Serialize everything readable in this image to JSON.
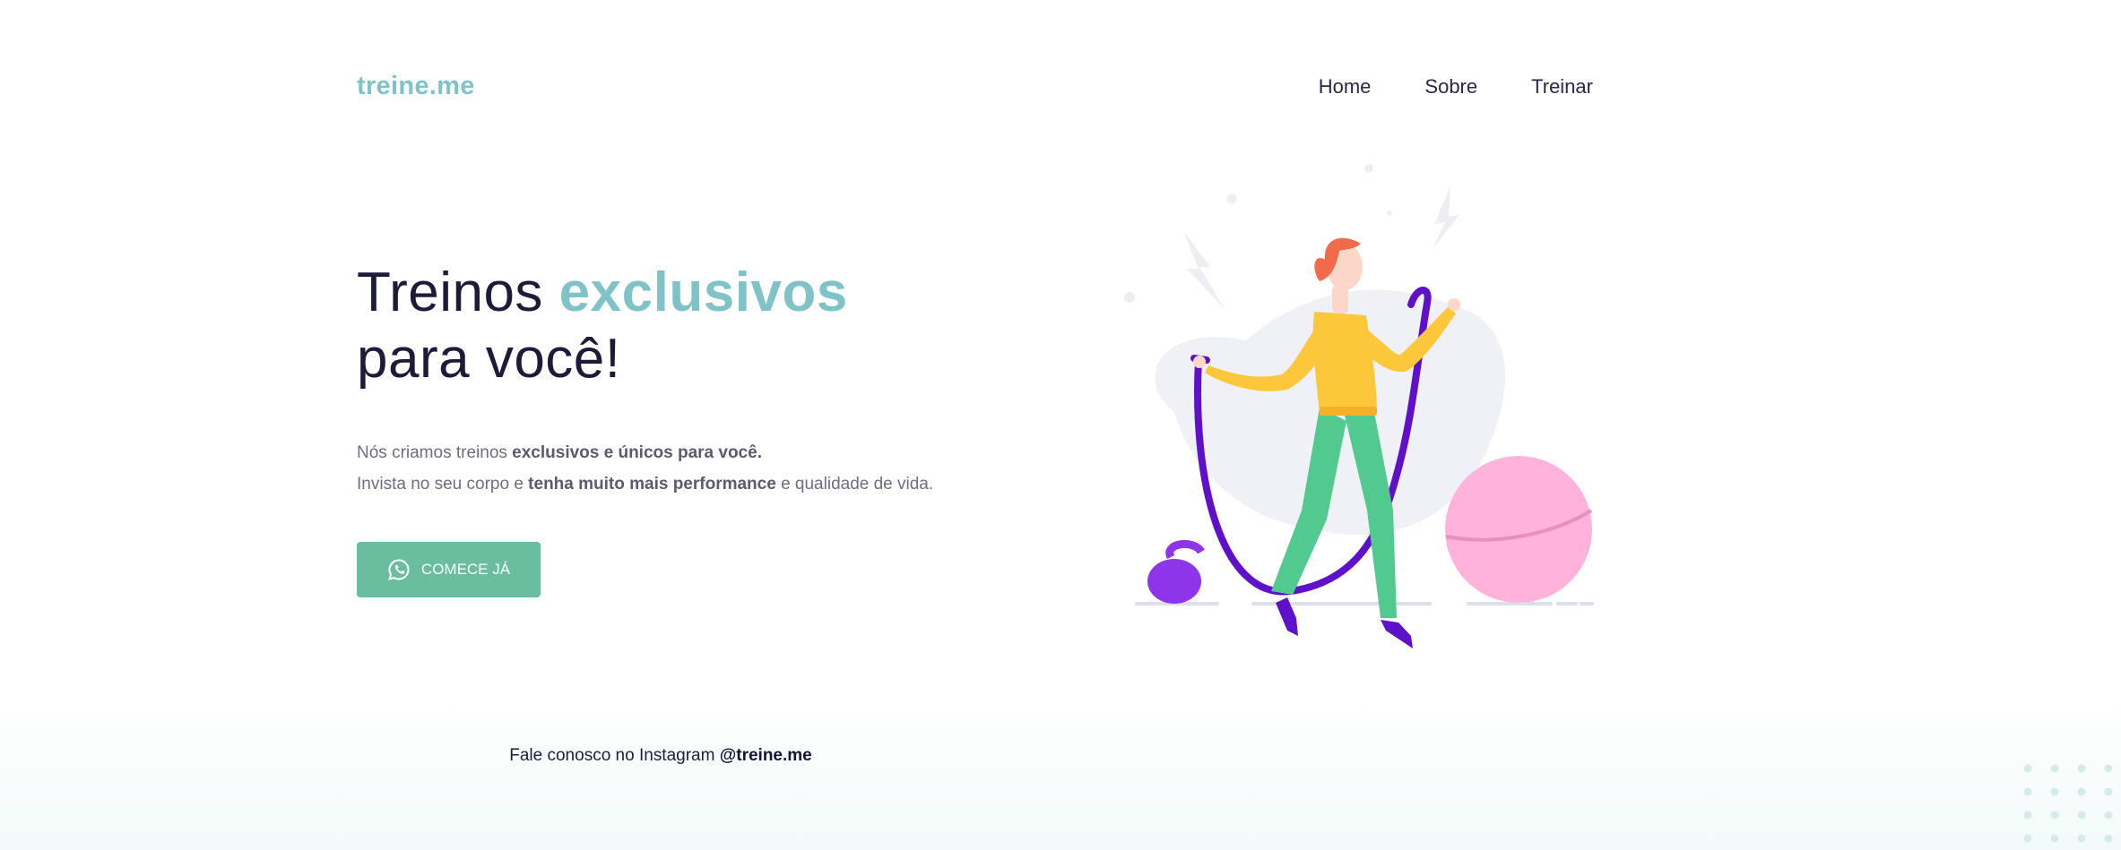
{
  "brand": {
    "logo": "treine.me"
  },
  "nav": {
    "items": [
      "Home",
      "Sobre",
      "Treinar"
    ]
  },
  "hero": {
    "title_part1": "Treinos ",
    "title_accent": "exclusivos",
    "title_part2": "para você!",
    "line1_pre": "Nós criamos treinos ",
    "line1_bold": "exclusivos e únicos para você.",
    "line2_pre": "Invista no seu corpo e ",
    "line2_bold": "tenha muito mais performance",
    "line2_post": " e qualidade de vida."
  },
  "cta": {
    "label": "COMECE JÁ",
    "icon": "whatsapp-icon"
  },
  "footer": {
    "text_pre": "Fale conosco no Instagram ",
    "handle": "@treine.me"
  },
  "colors": {
    "accent": "#7fc3c8",
    "button": "#6bbd9f",
    "heading": "#1d1b3a"
  }
}
